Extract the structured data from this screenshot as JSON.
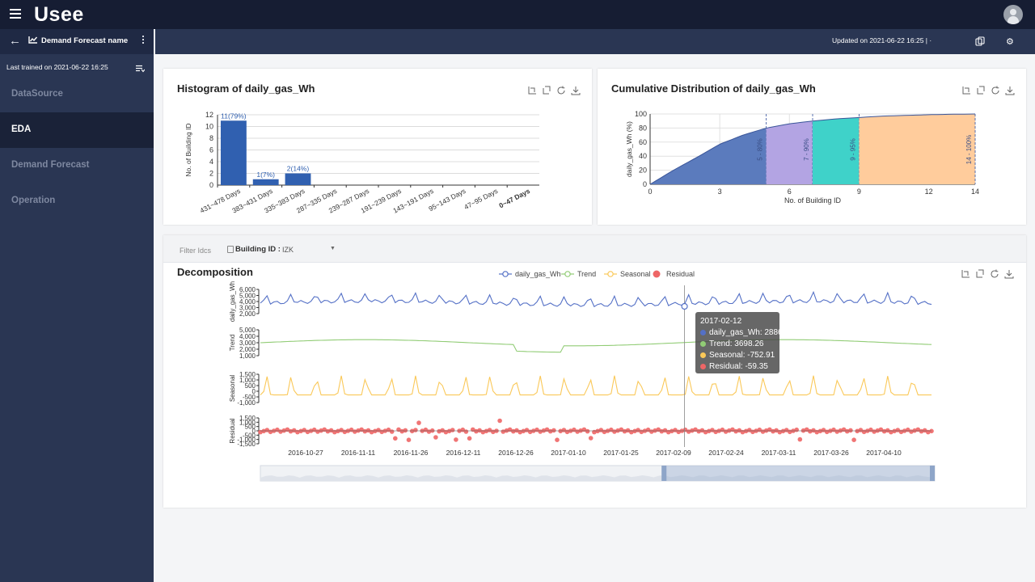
{
  "app": {
    "logo": "Usee"
  },
  "header": {
    "forecast_name": "Demand Forecast name",
    "updated": "Updated on 2021-06-22 16:25 | ·",
    "last_trained": "Last trained on 2021-06-22 16:25"
  },
  "nav": [
    {
      "label": "DataSource"
    },
    {
      "label": "EDA"
    },
    {
      "label": "Demand Forecast"
    },
    {
      "label": "Operation"
    }
  ],
  "nav_active": "EDA",
  "icons": [
    "menu-icon",
    "user-avatar-icon",
    "back-arrow-icon",
    "chart-line-icon",
    "kebab-icon",
    "list-filter-icon",
    "copy-icon",
    "gear-icon",
    "zoom-icon",
    "zoom-reset-icon",
    "restore-icon",
    "download-icon"
  ],
  "colors": {
    "topbar": "#161d33",
    "sidebar": "#2a3653",
    "bar": "#3060b0",
    "trend": "#91cc75",
    "seasonal": "#fac858",
    "residual": "#ee6666",
    "series": "#5470c6"
  },
  "histogram": {
    "title": "Histogram of daily_gas_Wh",
    "chart_data": {
      "type": "bar",
      "categories": [
        "431~478 Days",
        "383~431 Days",
        "335~383 Days",
        "287~335 Days",
        "239~287 Days",
        "191~239 Days",
        "143~191 Days",
        "95~143 Days",
        "47~95 Days",
        "0~47 Days"
      ],
      "values": [
        11,
        1,
        2,
        0,
        0,
        0,
        0,
        0,
        0,
        0
      ],
      "data_labels": [
        "11(79%)",
        "1(7%)",
        "2(14%)",
        "",
        "",
        "",
        "",
        "",
        "",
        ""
      ],
      "ylabel": "No. of Building ID",
      "yticks": [
        "0",
        "2",
        "4",
        "6",
        "8",
        "10",
        "12"
      ],
      "ylim": [
        0,
        12
      ],
      "grid": true
    }
  },
  "cumulative": {
    "title": "Cumulative Distribution of daily_gas_Wh",
    "chart_data": {
      "type": "area",
      "x": [
        0,
        1,
        2,
        3,
        4,
        5,
        6,
        7,
        8,
        9,
        10,
        11,
        12,
        13,
        14
      ],
      "y": [
        0,
        20,
        38,
        57,
        70,
        80,
        86,
        90,
        93,
        95,
        97,
        98,
        99,
        99.6,
        100
      ],
      "xlabel": "No. of Building ID",
      "ylabel": "daily_gas_Wh (%)",
      "xticks": [
        "0",
        "3",
        "6",
        "9",
        "12",
        "14"
      ],
      "yticks": [
        "0",
        "20",
        "40",
        "60",
        "80",
        "100"
      ],
      "xlim": [
        0,
        14
      ],
      "ylim": [
        0,
        100
      ],
      "segments": [
        {
          "from": 0,
          "to": 5,
          "label": "5 - 80%",
          "color": "#5b7bbd"
        },
        {
          "from": 5,
          "to": 7,
          "label": "7 - 90%",
          "color": "#b3a4e3"
        },
        {
          "from": 7,
          "to": 9,
          "label": "9 - 95%",
          "color": "#3fd2c9"
        },
        {
          "from": 9,
          "to": 14,
          "label": "14 - 100%",
          "color": "#ffcc9c"
        }
      ]
    }
  },
  "decomposition": {
    "title": "Decomposition",
    "filter_label": "Filter Idcs",
    "building_label": "Building ID :",
    "building_value": "IZK",
    "legend": [
      "daily_gas_Wh",
      "Trend",
      "Seasonal",
      "Residual"
    ],
    "tooltip": {
      "date": "2017-02-12",
      "rows": [
        {
          "label": "daily_gas_Wh: 2886",
          "color": "#5470c6"
        },
        {
          "label": "Trend: 3698.26",
          "color": "#91cc75"
        },
        {
          "label": "Seasonal: -752.91",
          "color": "#fac858"
        },
        {
          "label": "Residual: -59.35",
          "color": "#ee6666"
        }
      ]
    },
    "chart_data": {
      "type": "line",
      "x_ticks": [
        "2016-10-27",
        "2016-11-11",
        "2016-11-26",
        "2016-12-11",
        "2016-12-26",
        "2017-01-10",
        "2017-01-25",
        "2017-02-09",
        "2017-02-24",
        "2017-03-11",
        "2017-03-26",
        "2017-04-10"
      ],
      "panels": [
        {
          "name": "daily_gas_Wh",
          "yticks": [
            "2,000",
            "3,000",
            "4,000",
            "5,000",
            "6,000"
          ],
          "ylim": [
            1500,
            6500
          ]
        },
        {
          "name": "Trend",
          "yticks": [
            "1,000",
            "2,000",
            "3,000",
            "4,000",
            "5,000"
          ],
          "ylim": [
            700,
            5300
          ]
        },
        {
          "name": "Seasonal",
          "yticks": [
            "-1,000",
            "-500",
            "0",
            "500",
            "1,000",
            "1,500"
          ],
          "ylim": [
            -1150,
            1650
          ]
        },
        {
          "name": "Residual",
          "yticks": [
            "-1,500",
            "-1,000",
            "-500",
            "0",
            "500",
            "1,000",
            "1,500"
          ],
          "ylim": [
            -1700,
            1700
          ]
        }
      ]
    }
  }
}
